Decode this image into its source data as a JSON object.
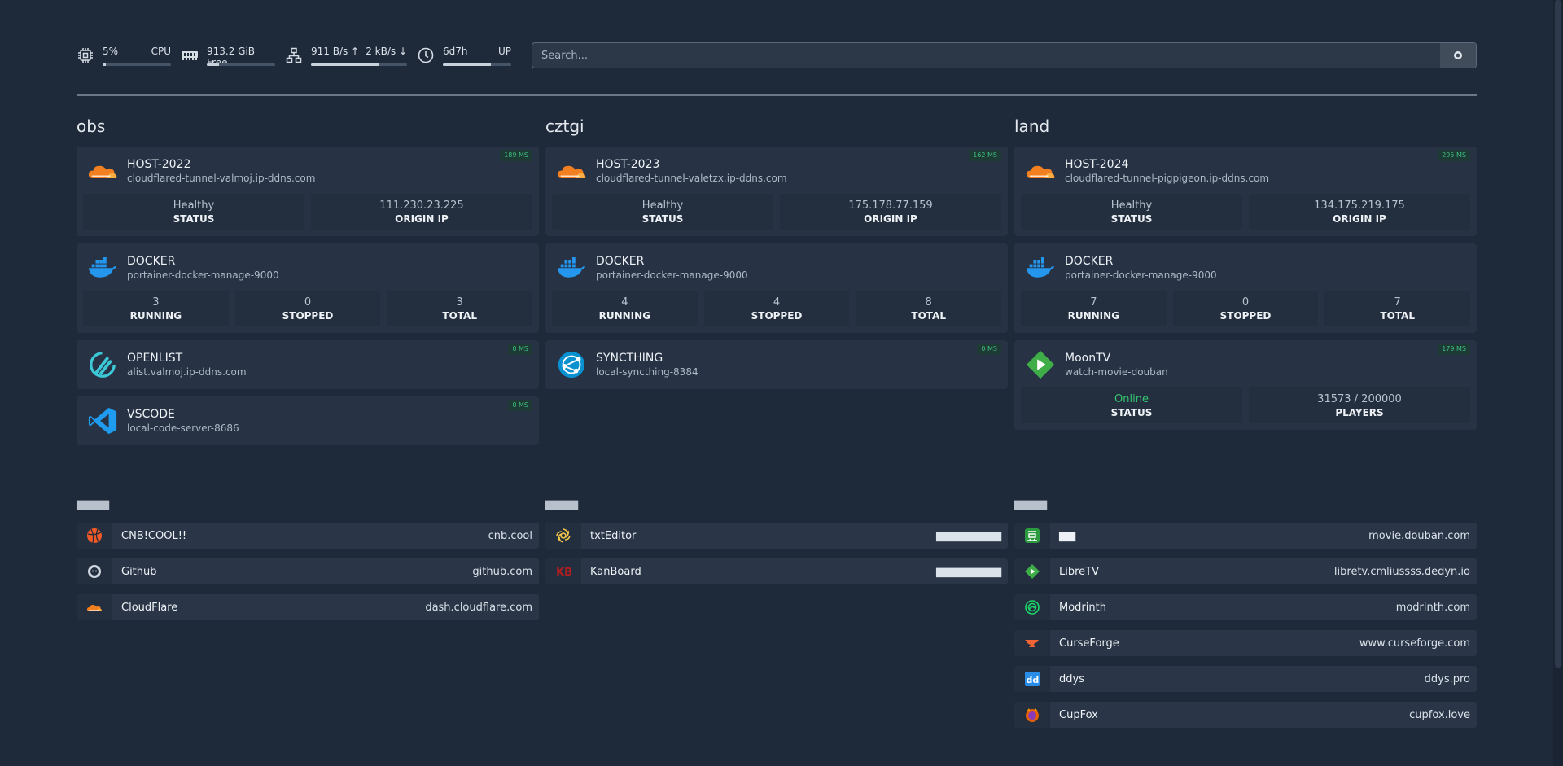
{
  "info": {
    "cpu": {
      "value": "5%",
      "label": "CPU",
      "level": 0.05
    },
    "memory": {
      "value": "913.2 GiB Free",
      "level": 0.18
    },
    "network": {
      "up": "911 B/s ↑",
      "down": "2 kB/s ↓",
      "level": 0.7
    },
    "uptime": {
      "value": "6d7h",
      "label": "UP",
      "level": 0.7
    }
  },
  "search": {
    "placeholder": "Search..."
  },
  "groups": [
    {
      "title": "obs",
      "cards": [
        {
          "name": "HOST-2022",
          "desc": "cloudflared-tunnel-valmoj.ip-ddns.com",
          "ping": "189 MS",
          "icon": "cloudflare-icon",
          "stats": [
            {
              "value": "Healthy",
              "label": "STATUS"
            },
            {
              "value": "111.230.23.225",
              "label": "ORIGIN IP"
            }
          ]
        },
        {
          "name": "DOCKER",
          "desc": "portainer-docker-manage-9000",
          "icon": "docker-icon",
          "stats": [
            {
              "value": "3",
              "label": "RUNNING"
            },
            {
              "value": "0",
              "label": "STOPPED"
            },
            {
              "value": "3",
              "label": "TOTAL"
            }
          ]
        },
        {
          "name": "OPENLIST",
          "desc": "alist.valmoj.ip-ddns.com",
          "ping": "0 MS",
          "icon": "openlist-icon"
        },
        {
          "name": "VSCODE",
          "desc": "local-code-server-8686",
          "ping": "0 MS",
          "icon": "vscode-icon"
        }
      ]
    },
    {
      "title": "cztgi",
      "cards": [
        {
          "name": "HOST-2023",
          "desc": "cloudflared-tunnel-valetzx.ip-ddns.com",
          "ping": "162 MS",
          "icon": "cloudflare-icon",
          "stats": [
            {
              "value": "Healthy",
              "label": "STATUS"
            },
            {
              "value": "175.178.77.159",
              "label": "ORIGIN IP"
            }
          ]
        },
        {
          "name": "DOCKER",
          "desc": "portainer-docker-manage-9000",
          "icon": "docker-icon",
          "stats": [
            {
              "value": "4",
              "label": "RUNNING"
            },
            {
              "value": "4",
              "label": "STOPPED"
            },
            {
              "value": "8",
              "label": "TOTAL"
            }
          ]
        },
        {
          "name": "SYNCTHING",
          "desc": "local-syncthing-8384",
          "ping": "0 MS",
          "icon": "syncthing-icon"
        }
      ]
    },
    {
      "title": "land",
      "cards": [
        {
          "name": "HOST-2024",
          "desc": "cloudflared-tunnel-pigpigeon.ip-ddns.com",
          "ping": "295 MS",
          "icon": "cloudflare-icon",
          "stats": [
            {
              "value": "Healthy",
              "label": "STATUS"
            },
            {
              "value": "134.175.219.175",
              "label": "ORIGIN IP"
            }
          ]
        },
        {
          "name": "DOCKER",
          "desc": "portainer-docker-manage-9000",
          "icon": "docker-icon",
          "stats": [
            {
              "value": "7",
              "label": "RUNNING"
            },
            {
              "value": "0",
              "label": "STOPPED"
            },
            {
              "value": "7",
              "label": "TOTAL"
            }
          ]
        },
        {
          "name": "MoonTV",
          "desc": "watch-movie-douban",
          "ping": "179 MS",
          "icon": "moontv-icon",
          "stats": [
            {
              "value": "Online",
              "label": "STATUS",
              "color": "#34c46f"
            },
            {
              "value": "31573 / 200000",
              "label": "PLAYERS"
            }
          ]
        }
      ]
    }
  ],
  "bookmarks": [
    {
      "title": "▆▆▆▆",
      "items": [
        {
          "name": "CNB!COOL!!",
          "url": "cnb.cool",
          "icon": "cnb-icon"
        },
        {
          "name": "Github",
          "url": "github.com",
          "icon": "github-icon"
        },
        {
          "name": "CloudFlare",
          "url": "dash.cloudflare.com",
          "icon": "cloudflare-icon"
        }
      ]
    },
    {
      "title": "▆▆▆▆",
      "items": [
        {
          "name": "txtEditor",
          "url": "▆▆▆▆▆▆▆▆",
          "icon": "openai-icon"
        },
        {
          "name": "KanBoard",
          "url": "▆▆▆▆▆▆▆▆",
          "icon": "kanboard-icon"
        }
      ]
    },
    {
      "title": "▆▆▆▆",
      "items": [
        {
          "name": "▆▆",
          "url": "movie.douban.com",
          "icon": "douban-icon"
        },
        {
          "name": "LibreTV",
          "url": "libretv.cmliussss.dedyn.io",
          "icon": "libretv-icon"
        },
        {
          "name": "Modrinth",
          "url": "modrinth.com",
          "icon": "modrinth-icon"
        },
        {
          "name": "CurseForge",
          "url": "www.curseforge.com",
          "icon": "curseforge-icon"
        },
        {
          "name": "ddys",
          "url": "ddys.pro",
          "icon": "ddys-icon"
        },
        {
          "name": "CupFox",
          "url": "cupfox.love",
          "icon": "cupfox-icon"
        }
      ]
    }
  ]
}
